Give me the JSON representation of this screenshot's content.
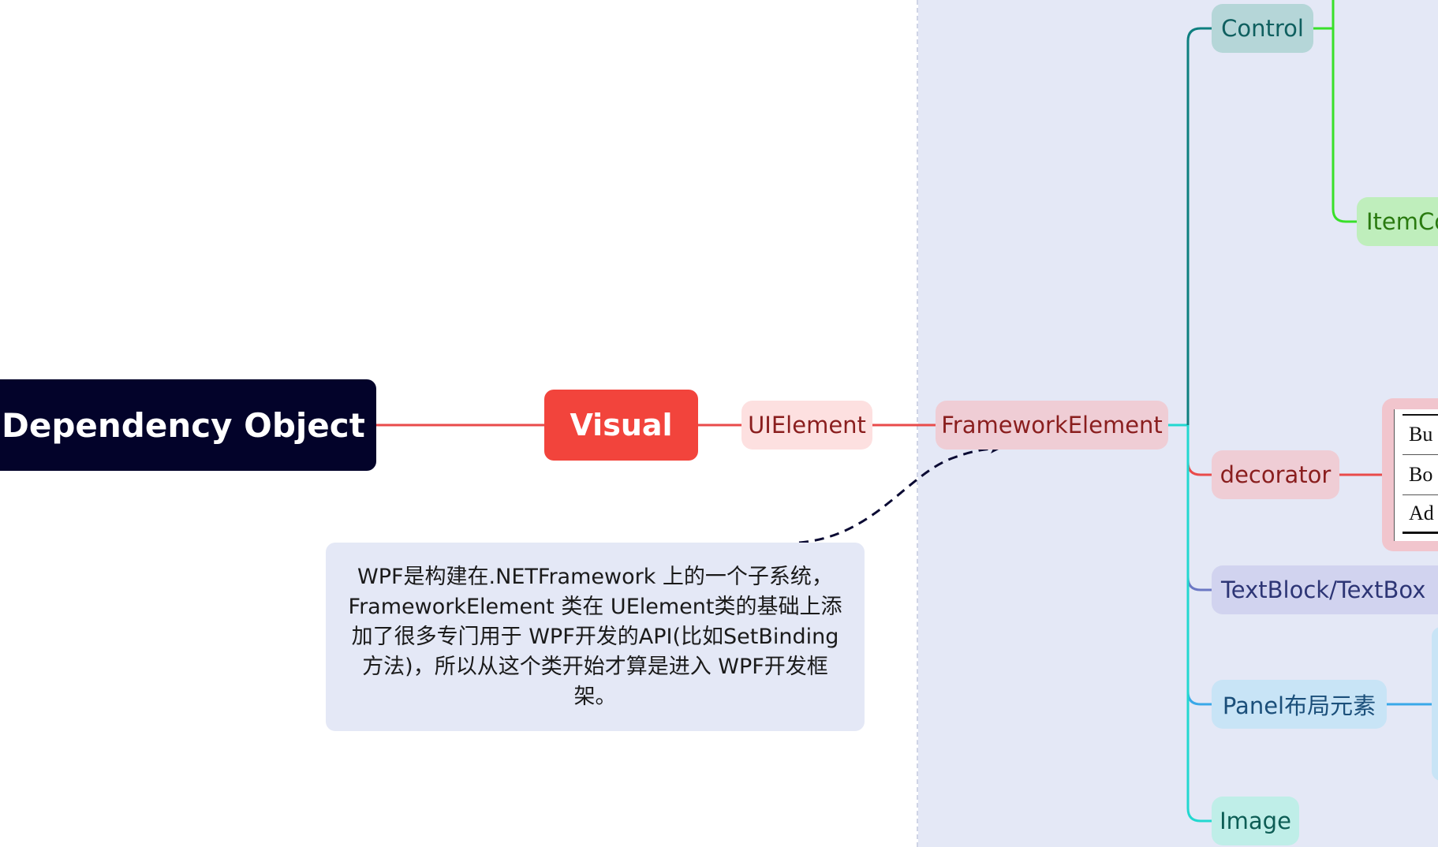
{
  "colors": {
    "root_bg": "#03032a",
    "visual_bg": "#f2443c",
    "main_line": "#e94b4b",
    "control_line": "#0e7f7f",
    "itemco_line": "#39e02a",
    "textblock_line": "#6b78c4",
    "panel_line": "#3aa8e8",
    "image_line": "#22d8d0",
    "region_bg": "#e4e8f6"
  },
  "nodes": {
    "root": "Dependency Object",
    "visual": "Visual",
    "uielement": "UIElement",
    "framework": "FrameworkElement",
    "control": "Control",
    "itemco": "ItemCo",
    "decorator": "decorator",
    "textblock": "TextBlock/TextBox",
    "panel": "Panel布局元素",
    "image": "Image"
  },
  "decorator_children": [
    "Bu",
    "Bo",
    "Ad"
  ],
  "note": {
    "text": "WPF是构建在.NETFramework 上的一个子系统，FrameworkElement 类在 UElement类的基础上添加了很多专门用于 WPF开发的API(比如SetBinding方法)，所以从这个类开始才算是进入 WPF开发框架。"
  }
}
